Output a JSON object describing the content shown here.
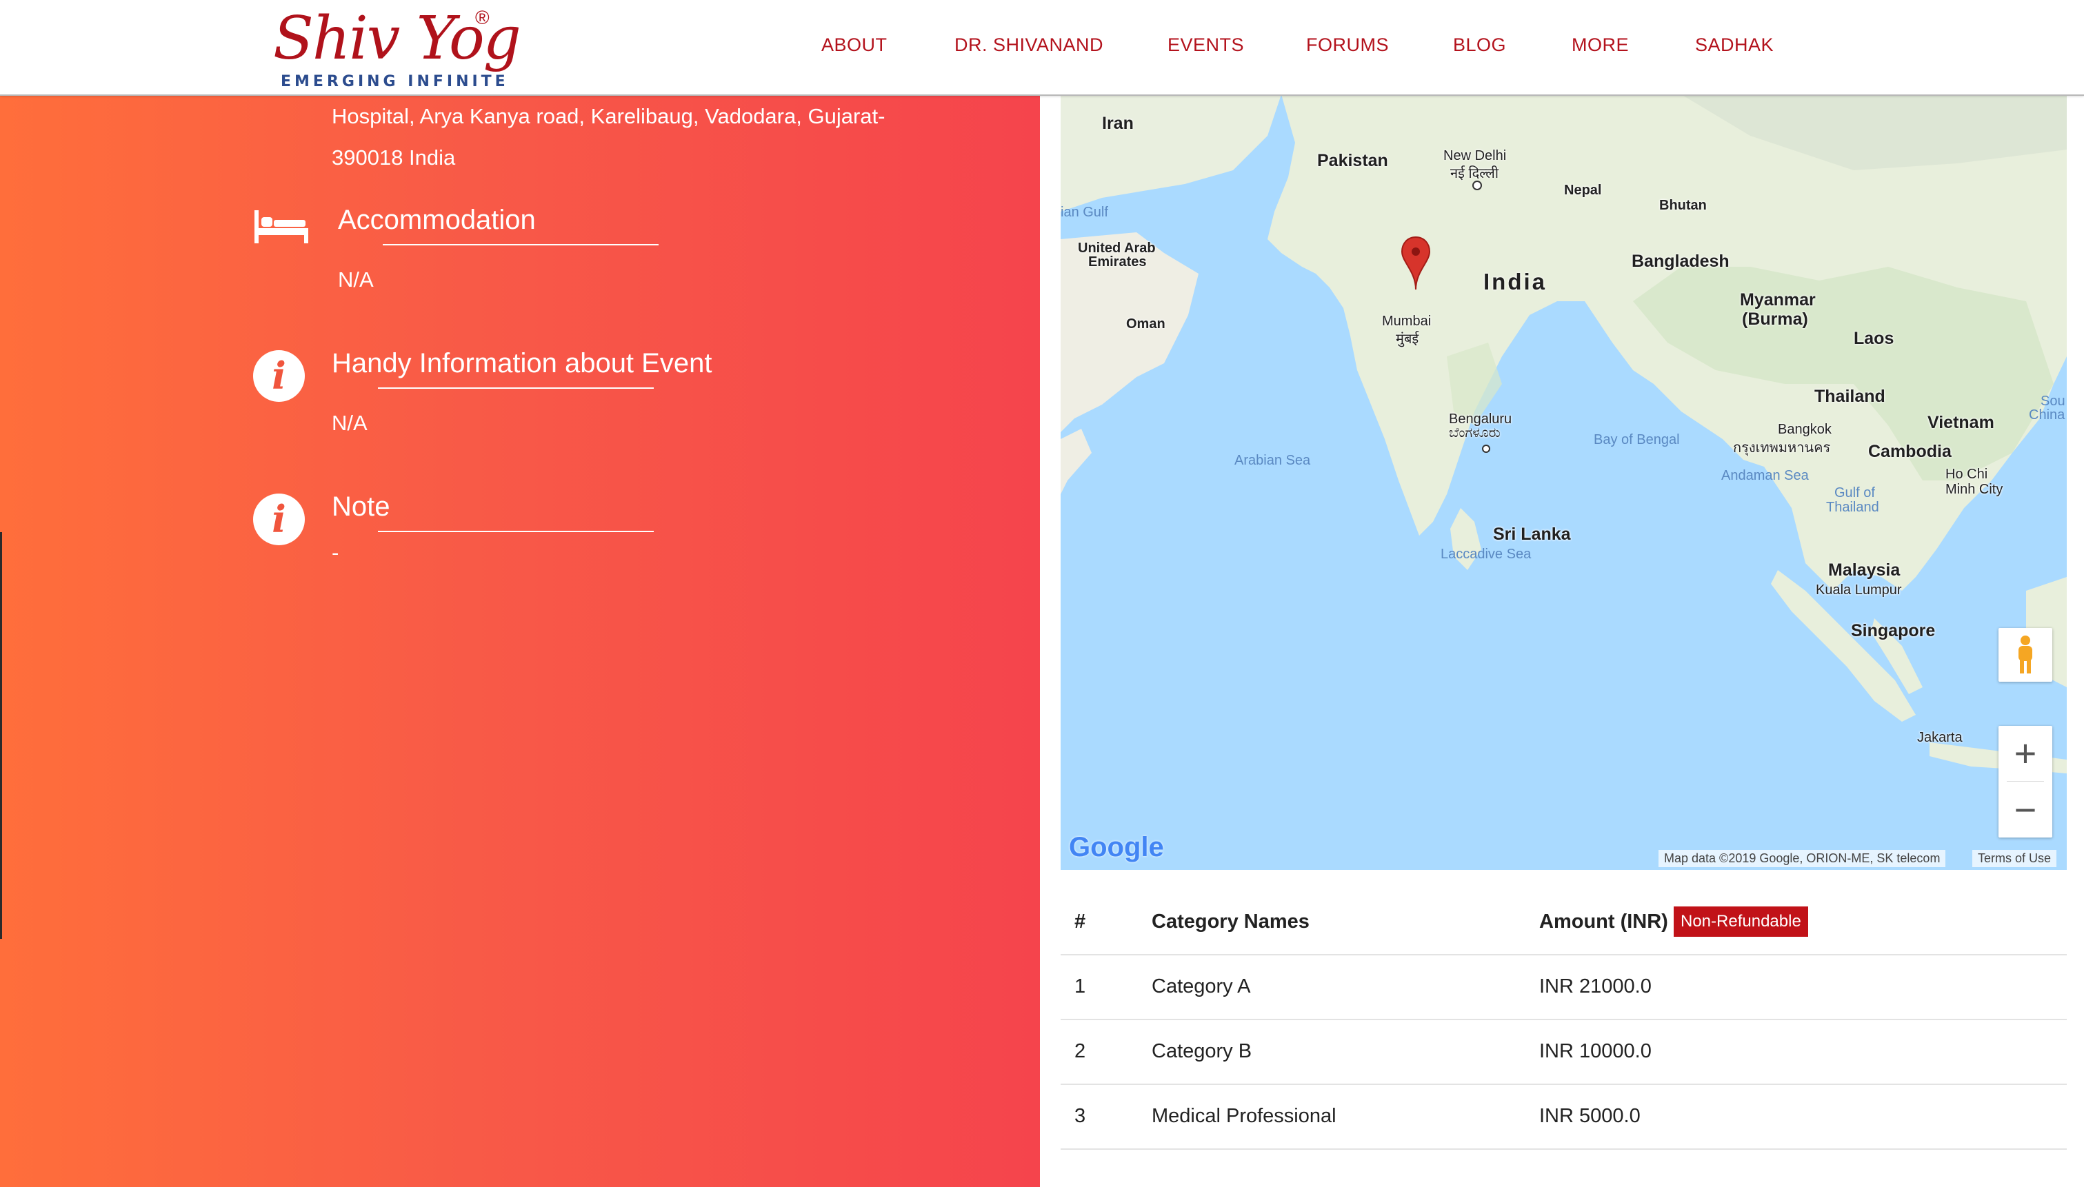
{
  "header": {
    "logo_text": "Shiv Yog",
    "logo_reg": "®",
    "logo_tagline": "EMERGING INFINITE",
    "nav": [
      {
        "label": "ABOUT"
      },
      {
        "label": "DR. SHIVANAND"
      },
      {
        "label": "EVENTS"
      },
      {
        "label": "FORUMS"
      },
      {
        "label": "BLOG"
      },
      {
        "label": "MORE"
      },
      {
        "label": "SADHAK"
      }
    ]
  },
  "details": {
    "address_line1": "Hospital, Arya Kanya road, Karelibaug, Vadodara, Gujarat-",
    "address_line2": "390018 India",
    "accommodation": {
      "title": "Accommodation",
      "value": "N/A"
    },
    "handy_info": {
      "title": "Handy Information about Event",
      "value": "N/A"
    },
    "note": {
      "title": "Note",
      "value": "-"
    }
  },
  "map": {
    "labels": {
      "iran": "Iran",
      "pakistan": "Pakistan",
      "new_delhi": "New Delhi",
      "new_delhi_local": "नई दिल्ली",
      "nepal": "Nepal",
      "bhutan": "Bhutan",
      "gulf": "ian Gulf",
      "uae1": "United Arab",
      "uae2": "Emirates",
      "india": "India",
      "bangladesh": "Bangladesh",
      "myanmar1": "Myanmar",
      "myanmar2": "(Burma)",
      "oman": "Oman",
      "mumbai": "Mumbai",
      "mumbai_local": "मुंबई",
      "laos": "Laos",
      "thailand": "Thailand",
      "bengaluru": "Bengaluru",
      "bengaluru_local": "ಬೆಂಗಳೂರು",
      "bay_of_bengal": "Bay of Bengal",
      "bangkok": "Bangkok",
      "bangkok_local": "กรุงเทพมหานคร",
      "vietnam": "Vietnam",
      "south_china1": "Sou",
      "south_china2": "China",
      "arabian_sea": "Arabian Sea",
      "andaman_sea": "Andaman Sea",
      "cambodia": "Cambodia",
      "ho_chi_minh1": "Ho Chi",
      "ho_chi_minh2": "Minh City",
      "gulf_thailand1": "Gulf of",
      "gulf_thailand2": "Thailand",
      "sri_lanka": "Sri Lanka",
      "laccadive_sea": "Laccadive Sea",
      "malaysia": "Malaysia",
      "kuala_lumpur": "Kuala Lumpur",
      "singapore": "Singapore",
      "jakarta": "Jakarta"
    },
    "google_logo": "Google",
    "attribution": "Map data ©2019 Google, ORION-ME, SK telecom",
    "terms": "Terms of Use",
    "zoom_in": "+",
    "zoom_out": "−",
    "colors": {
      "water": "#aadaff",
      "land": "#e9efdf",
      "marker": "#d7342b"
    }
  },
  "fees": {
    "columns": {
      "num": "#",
      "name": "Category Names",
      "amount": "Amount (INR)",
      "badge": "Non-Refundable"
    },
    "rows": [
      {
        "num": "1",
        "name": "Category A",
        "amount": "INR 21000.0"
      },
      {
        "num": "2",
        "name": "Category B",
        "amount": "INR 10000.0"
      },
      {
        "num": "3",
        "name": "Medical Professional",
        "amount": "INR 5000.0"
      }
    ]
  }
}
